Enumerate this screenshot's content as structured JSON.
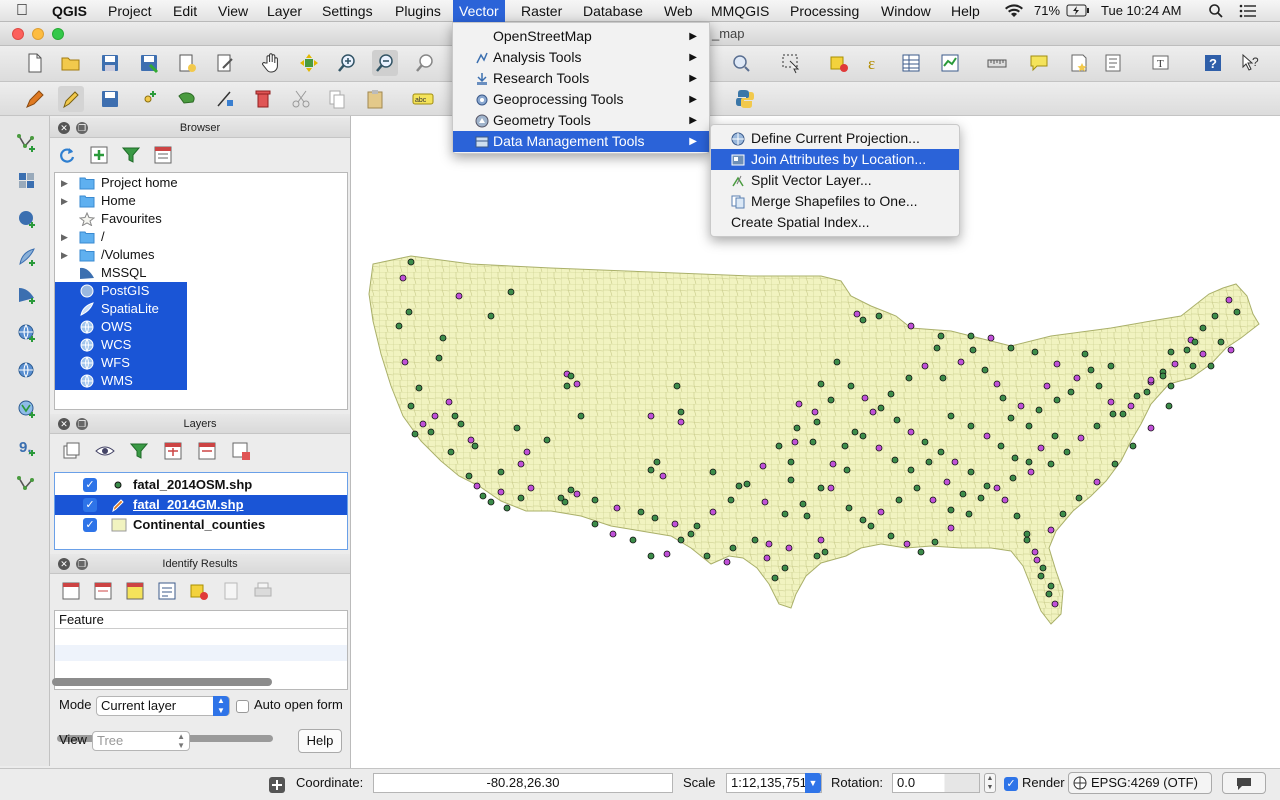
{
  "menubar": {
    "app": "QGIS",
    "items": [
      "Project",
      "Edit",
      "View",
      "Layer",
      "Settings",
      "Plugins",
      "Vector",
      "Raster",
      "Database",
      "Web",
      "MMQGIS",
      "Processing",
      "Window",
      "Help"
    ],
    "active": "Vector",
    "battery": "71%",
    "clock": "Tue 10:24 AM"
  },
  "window": {
    "title_fragment": "_map"
  },
  "vector_menu": {
    "items": [
      {
        "label": "OpenStreetMap",
        "icon": "none-icon"
      },
      {
        "label": "Analysis Tools",
        "icon": "analysis-icon"
      },
      {
        "label": "Research Tools",
        "icon": "research-icon"
      },
      {
        "label": "Geoprocessing Tools",
        "icon": "geoprocessing-icon"
      },
      {
        "label": "Geometry Tools",
        "icon": "geometry-icon"
      },
      {
        "label": "Data Management Tools",
        "icon": "data-management-icon"
      }
    ],
    "highlighted": "Data Management Tools"
  },
  "data_mgmt_submenu": {
    "items": [
      {
        "label": "Define Current Projection...",
        "icon": "projection-icon"
      },
      {
        "label": "Join Attributes by Location...",
        "icon": "join-icon"
      },
      {
        "label": "Split Vector Layer...",
        "icon": "split-icon"
      },
      {
        "label": "Merge Shapefiles to One...",
        "icon": "merge-icon"
      },
      {
        "label": "Create Spatial Index...",
        "icon": "none-icon"
      }
    ],
    "highlighted": "Join Attributes by Location..."
  },
  "browser": {
    "title": "Browser",
    "items": [
      {
        "label": "Project home",
        "expandable": true,
        "icon": "folder-icon",
        "selected": false
      },
      {
        "label": "Home",
        "expandable": true,
        "icon": "folder-icon",
        "selected": false
      },
      {
        "label": "Favourites",
        "expandable": false,
        "icon": "star-icon",
        "selected": false
      },
      {
        "label": "/",
        "expandable": true,
        "icon": "folder-icon",
        "selected": false
      },
      {
        "label": "/Volumes",
        "expandable": true,
        "icon": "folder-icon",
        "selected": false
      },
      {
        "label": "MSSQL",
        "expandable": false,
        "icon": "mssql-icon",
        "selected": false
      },
      {
        "label": "PostGIS",
        "expandable": false,
        "icon": "postgis-icon",
        "selected": true
      },
      {
        "label": "SpatiaLite",
        "expandable": false,
        "icon": "spatialite-icon",
        "selected": true
      },
      {
        "label": "OWS",
        "expandable": false,
        "icon": "globe-icon",
        "selected": true
      },
      {
        "label": "WCS",
        "expandable": false,
        "icon": "globe-icon",
        "selected": true
      },
      {
        "label": "WFS",
        "expandable": false,
        "icon": "globe-icon",
        "selected": true
      },
      {
        "label": "WMS",
        "expandable": false,
        "icon": "globe-icon",
        "selected": true
      }
    ]
  },
  "layers": {
    "title": "Layers",
    "items": [
      {
        "label": "fatal_2014OSM.shp",
        "checked": true,
        "selected": false,
        "symbol": "green-point"
      },
      {
        "label": "fatal_2014GM.shp",
        "checked": true,
        "selected": true,
        "symbol": "pencil-edit"
      },
      {
        "label": "Continental_counties",
        "checked": true,
        "selected": false,
        "symbol": "polygon-fill"
      }
    ]
  },
  "identify": {
    "title": "Identify Results",
    "column_header": "Feature",
    "mode_label": "Mode",
    "mode_value": "Current layer",
    "auto_open_label": "Auto open form",
    "auto_open_checked": false,
    "view_label": "View",
    "view_value": "Tree",
    "help_label": "Help"
  },
  "status": {
    "coordinate_label": "Coordinate:",
    "coordinate_value": "-80.28,26.30",
    "scale_label": "Scale",
    "scale_value": "1:12,135,751",
    "rotation_label": "Rotation:",
    "rotation_value": "0.0",
    "render_label": "Render",
    "render_checked": true,
    "crs": "EPSG:4269 (OTF)"
  },
  "colors": {
    "menu_highlight": "#2b63d8",
    "selection": "#1a55d6",
    "county_fill": "#f1f3c0",
    "county_line": "#c8cb8a",
    "osm_point": "#3c8c4a",
    "gm_point": "#c050d8"
  }
}
